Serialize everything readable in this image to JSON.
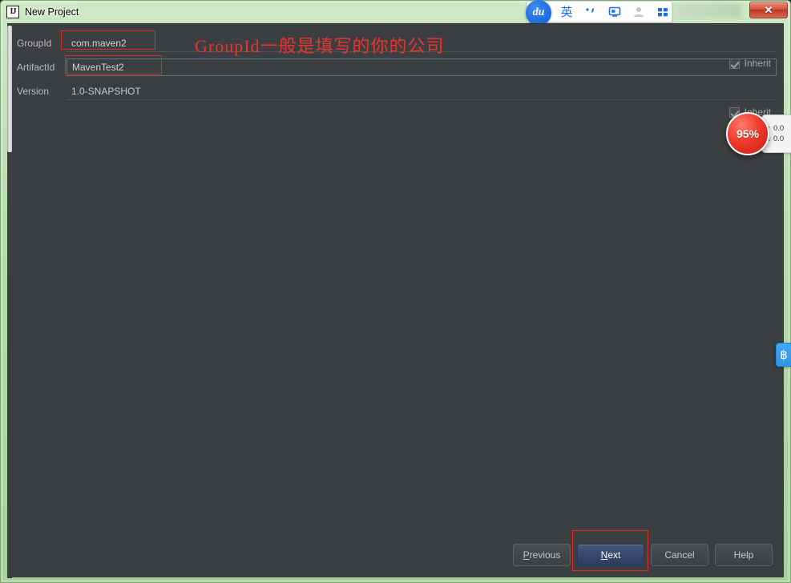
{
  "window": {
    "title": "New Project",
    "app_icon": "intellij-idea-icon",
    "close_label": "✕",
    "frame_color": "#b6dcab"
  },
  "ime": {
    "name": "baidu-ime",
    "logo_text": "du",
    "items": [
      {
        "name": "language-mode",
        "glyph": "英"
      },
      {
        "name": "punctuation-mode",
        "glyph": "，"
      },
      {
        "name": "soft-keyboard",
        "glyph": "keyboard"
      },
      {
        "name": "user-account",
        "glyph": "person"
      },
      {
        "name": "toolbox-apps",
        "glyph": "grid"
      }
    ]
  },
  "form": {
    "fields": [
      {
        "name": "groupid",
        "label": "GroupId",
        "value": "com.maven2",
        "placeholder": "",
        "focused": false,
        "inherit_label": "Inherit",
        "inherit_checked": true
      },
      {
        "name": "artifactid",
        "label": "ArtifactId",
        "value": "MavenTest2",
        "placeholder": "",
        "focused": true,
        "inherit_label": "",
        "inherit_checked": false
      },
      {
        "name": "version",
        "label": "Version",
        "value": "1.0-SNAPSHOT",
        "placeholder": "",
        "focused": false,
        "inherit_label": "Inherit",
        "inherit_checked": true
      }
    ]
  },
  "annotation": {
    "text": "GroupId一般是填写的你的公司",
    "color": "#e8342b",
    "boxes": [
      "groupid-field",
      "artifactid-field",
      "next-button"
    ]
  },
  "buttons": {
    "previous": {
      "label": "Previous",
      "mnemonic": "P",
      "rest": "revious"
    },
    "next": {
      "label": "Next",
      "mnemonic": "N",
      "rest": "ext"
    },
    "cancel": {
      "label": "Cancel",
      "mnemonic": "",
      "rest": "Cancel"
    },
    "help": {
      "label": "Help",
      "mnemonic": "",
      "rest": "Help"
    }
  },
  "widgets": {
    "cpu_bubble": {
      "value": "95%",
      "color": "#ef3b2c"
    },
    "netspeed": {
      "upload": "0.0",
      "download": "0.0",
      "up_arrow": "↑",
      "down_arrow": "↓"
    },
    "edge_widget": {
      "glyph": "฿"
    }
  }
}
